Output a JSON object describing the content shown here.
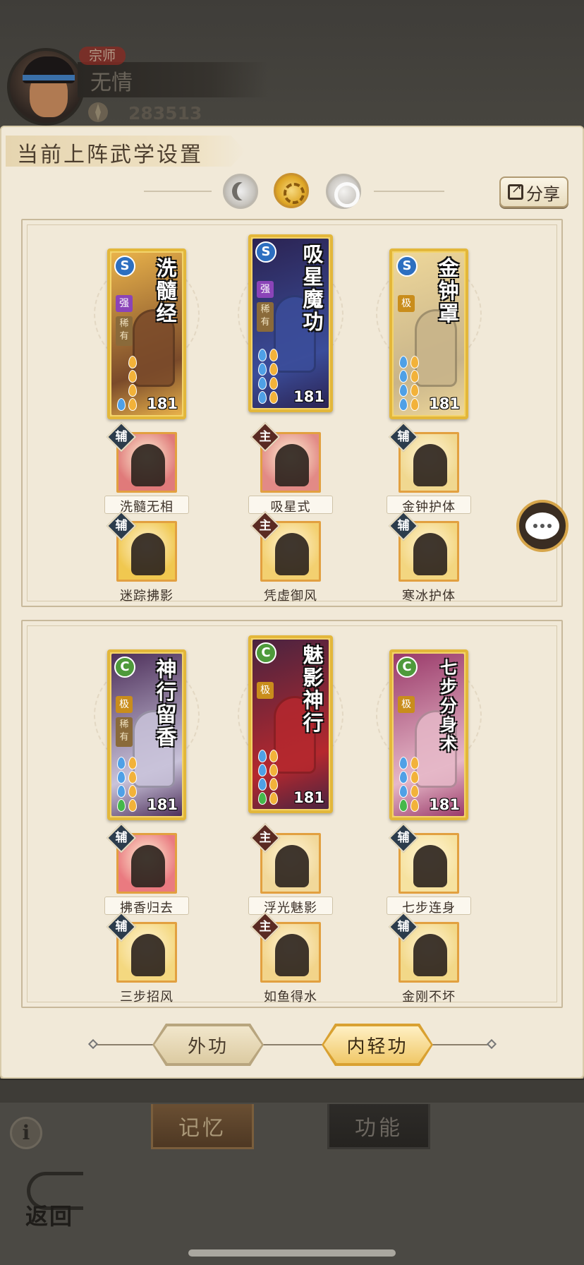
{
  "profile": {
    "rank": "宗师",
    "name": "无情",
    "power": "283513"
  },
  "panel": {
    "title": "当前上阵武学设置",
    "share_label": "分享"
  },
  "sections": [
    {
      "cards": [
        {
          "title": "洗髓经",
          "type": "S",
          "tier": "强",
          "rare": "稀有",
          "level": "181",
          "art": "#7a4a2a",
          "bg": "#e9b24a"
        },
        {
          "title": "吸星魔功",
          "type": "S",
          "tier": "强",
          "rare": "稀有",
          "level": "181",
          "art": "#3b4d9a",
          "bg": "#2b2352"
        },
        {
          "title": "金钟罩",
          "type": "S",
          "tier": "极",
          "rare": "",
          "level": "181",
          "art": "#c8b48a",
          "bg": "#eed79a"
        }
      ],
      "skills_row1": [
        {
          "role": "辅",
          "name": "洗髓无相",
          "bg": "#e07a7a"
        },
        {
          "role": "主",
          "name": "吸星式",
          "bg": "#e28a86"
        },
        {
          "role": "辅",
          "name": "金钟护体",
          "bg": "#f0d890"
        }
      ],
      "skills_row2": [
        {
          "role": "辅",
          "name": "迷踪拂影",
          "bg": "#f0c850"
        },
        {
          "role": "主",
          "name": "凭虚御风",
          "bg": "#f3d070"
        },
        {
          "role": "辅",
          "name": "寒冰护体",
          "bg": "#f3d680"
        }
      ]
    },
    {
      "cards": [
        {
          "title": "神行留香",
          "type": "C",
          "tier": "极",
          "rare": "稀有",
          "level": "181",
          "art": "#c9c3da",
          "bg": "#4d2f5a"
        },
        {
          "title": "魅影神行",
          "type": "C",
          "tier": "极",
          "rare": "",
          "level": "181",
          "art": "#b5282e",
          "bg": "#4a2440"
        },
        {
          "title": "七步分身术",
          "type": "C",
          "tier": "极",
          "rare": "",
          "level": "181",
          "art": "#e6b8c8",
          "bg": "#9a3a6a"
        }
      ],
      "skills_row1": [
        {
          "role": "辅",
          "name": "拂香归去",
          "bg": "#ea7a80"
        },
        {
          "role": "主",
          "name": "浮光魅影",
          "bg": "#f1d89a"
        },
        {
          "role": "辅",
          "name": "七步连身",
          "bg": "#f6e2a0"
        }
      ],
      "skills_row2": [
        {
          "role": "辅",
          "name": "三步招风",
          "bg": "#f4d880"
        },
        {
          "role": "主",
          "name": "如鱼得水",
          "bg": "#f2d48a"
        },
        {
          "role": "辅",
          "name": "金刚不坏",
          "bg": "#f2d888"
        }
      ]
    }
  ],
  "tabs": {
    "outer": "外功",
    "inner": "内轻功"
  },
  "bottom": {
    "memory": "记忆",
    "function": "功能",
    "back": "返回",
    "info": "i"
  }
}
